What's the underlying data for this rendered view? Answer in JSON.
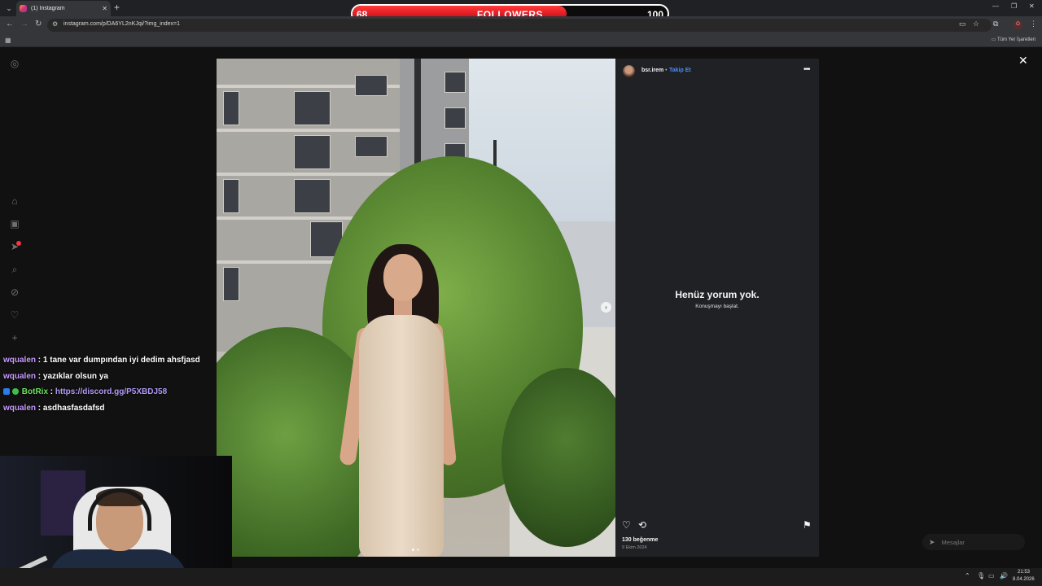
{
  "browser": {
    "tab_title": "(1) Instagram",
    "url": "instagram.com/p/DA6YL2nKJqi/?img_index=1",
    "bookmarks_all": "Tüm Yer İşaretleri",
    "profile_initial": "O"
  },
  "followers_goal": {
    "label": "FOLLOWERS",
    "current": "68",
    "goal": "100",
    "progress_fraction": 0.68
  },
  "post": {
    "username": "bsr.irem",
    "follow": "Takip Et",
    "no_comments": "Henüz yorum yok.",
    "start_conversation": "Konuşmayı başlat.",
    "likes": "130 beğenme",
    "date": "9 Ekim 2024"
  },
  "messages": {
    "label": "Mesajlar"
  },
  "chat": [
    {
      "user": "wqualen",
      "text": "1 tane var dumpından iyi dedim ahsfjasd",
      "kind": "user"
    },
    {
      "user": "wqualen",
      "text": "yazıklar olsun ya",
      "kind": "user"
    },
    {
      "user": "BotRix",
      "text": "https://discord.gg/P5XBDJ58",
      "kind": "bot"
    },
    {
      "user": "wqualen",
      "text": "asdhasfasdafsd",
      "kind": "user"
    }
  ],
  "taskbar": {
    "time": "21:53",
    "date": "8.04.2026"
  },
  "colors": {
    "follow_link": "#4a8dfc",
    "follower_bar": "#e3101e",
    "chat_user": "#c69bff",
    "chat_bot": "#6ce05f"
  },
  "icons": {
    "sidebar": [
      "instagram-icon",
      "home-icon",
      "reels-icon",
      "direct-icon",
      "search-icon",
      "explore-icon",
      "heart-icon",
      "create-icon"
    ],
    "post_actions": [
      "heart-icon",
      "repost-icon",
      "bookmark-icon"
    ]
  }
}
